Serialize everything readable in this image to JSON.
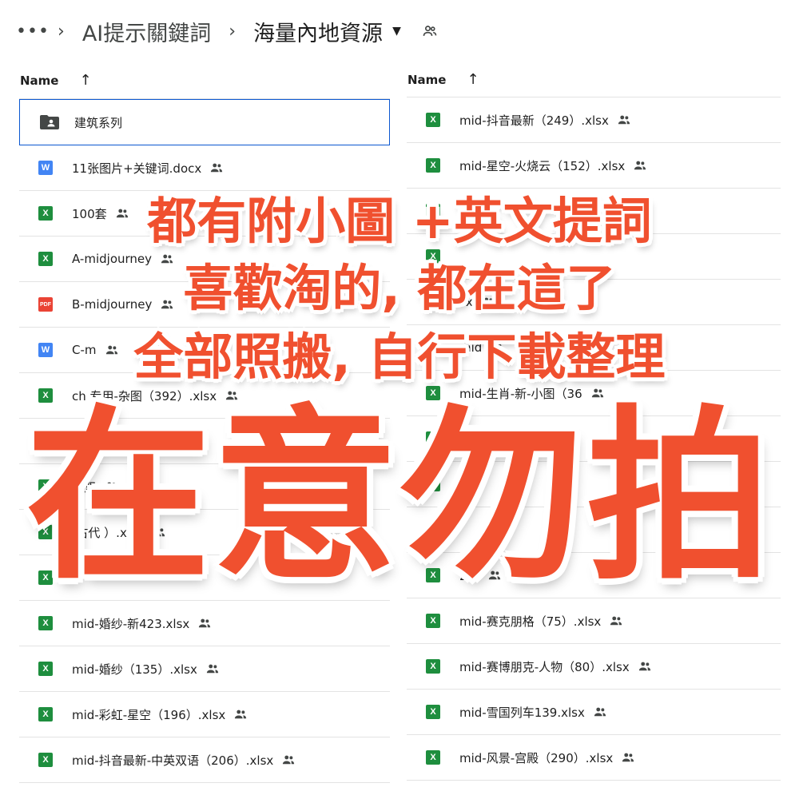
{
  "breadcrumb": {
    "more": "•••",
    "sep": "›",
    "parent": "AI提示關鍵詞",
    "current": "海量內地資源",
    "caret": "▼"
  },
  "left": {
    "header": {
      "name": "Name",
      "sort": "↑"
    },
    "rows": [
      {
        "type": "folder",
        "icon": "",
        "name": "建筑系列"
      },
      {
        "type": "docx",
        "icon": "W",
        "name": "11张图片+关键词.docx"
      },
      {
        "type": "xlsx",
        "icon": "X",
        "name": "100套"
      },
      {
        "type": "xlsx",
        "icon": "X",
        "name": "A-midjourney"
      },
      {
        "type": "pdf",
        "icon": "PDF",
        "name": "B-midjourney"
      },
      {
        "type": "docx",
        "icon": "W",
        "name": "C-m"
      },
      {
        "type": "xlsx",
        "icon": "X",
        "name": "ch    专用-杂图（392）.xlsx"
      },
      {
        "type": "xlsx",
        "icon": "X",
        "name": ""
      },
      {
        "type": "xlsx",
        "icon": "X",
        "name": "英双"
      },
      {
        "type": "xlsx",
        "icon": "X",
        "name": "-古代      ）.xlsx"
      },
      {
        "type": "xlsx",
        "icon": "X",
        "name": ""
      },
      {
        "type": "xlsx",
        "icon": "X",
        "name": "mid-婚纱-新423.xlsx"
      },
      {
        "type": "xlsx",
        "icon": "X",
        "name": "mid-婚纱（135）.xlsx"
      },
      {
        "type": "xlsx",
        "icon": "X",
        "name": "mid-彩虹-星空（196）.xlsx"
      },
      {
        "type": "xlsx",
        "icon": "X",
        "name": "mid-抖音最新-中英双语（206）.xlsx"
      }
    ]
  },
  "right": {
    "header": {
      "name": "Name",
      "sort": "↑"
    },
    "rows": [
      {
        "type": "xlsx",
        "icon": "X",
        "name": "mid-抖音最新（249）.xlsx"
      },
      {
        "type": "xlsx",
        "icon": "X",
        "name": "mid-星空-火烧云（152）.xlsx"
      },
      {
        "type": "xlsx",
        "icon": "X",
        "name": ""
      },
      {
        "type": "xlsx",
        "icon": "X",
        "name": ""
      },
      {
        "type": "xlsx",
        "icon": "X",
        "name": "sx"
      },
      {
        "type": "xlsx",
        "icon": "X",
        "name": "mid"
      },
      {
        "type": "xlsx",
        "icon": "X",
        "name": "mid-生肖-新-小图（36"
      },
      {
        "type": "xlsx",
        "icon": "X",
        "name": ""
      },
      {
        "type": "xlsx",
        "icon": "X",
        "name": ""
      },
      {
        "type": "xlsx",
        "icon": "X",
        "name": ""
      },
      {
        "type": "xlsx",
        "icon": "X",
        "name": "2）"
      },
      {
        "type": "xlsx",
        "icon": "X",
        "name": "mid-赛克朋格（75）.xlsx"
      },
      {
        "type": "xlsx",
        "icon": "X",
        "name": "mid-赛博朋克-人物（80）.xlsx"
      },
      {
        "type": "xlsx",
        "icon": "X",
        "name": "mid-雪国列车139.xlsx"
      },
      {
        "type": "xlsx",
        "icon": "X",
        "name": "mid-风景-宫殿（290）.xlsx"
      }
    ]
  },
  "overlay": {
    "line1": "都有附小圖 +英文提詞",
    "line2": "喜歡淘的, 都在這了",
    "line3": "全部照搬, 自行下載整理",
    "big": "在意勿拍",
    "color": "#f0502f"
  }
}
